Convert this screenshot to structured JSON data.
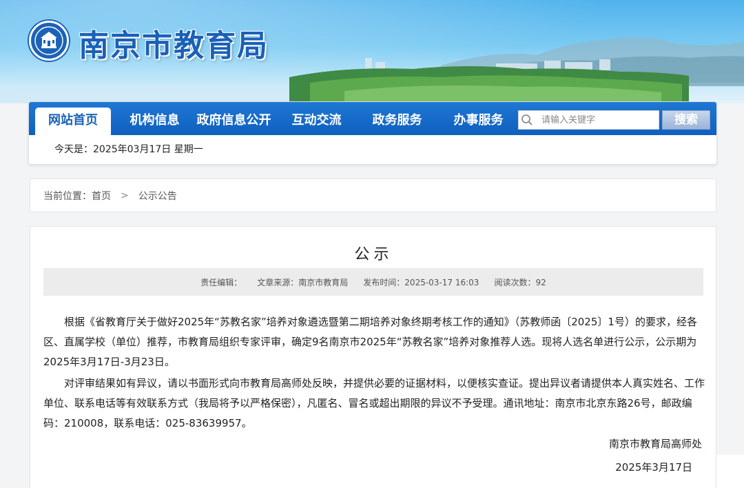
{
  "site": {
    "title": "南京市教育局"
  },
  "nav": {
    "items": [
      {
        "label": "网站首页",
        "active": true
      },
      {
        "label": "机构信息",
        "active": false
      },
      {
        "label": "政府信息公开",
        "active": false
      },
      {
        "label": "互动交流",
        "active": false
      },
      {
        "label": "政务服务",
        "active": false
      },
      {
        "label": "办事服务",
        "active": false
      }
    ],
    "search_placeholder": "请输入关键字",
    "search_button": "搜索",
    "today_text": "今天是：2025年03月17日  星期一"
  },
  "breadcrumb": {
    "prefix": "当前位置：",
    "home": "首页",
    "separator": ">",
    "current": "公示公告"
  },
  "article": {
    "title": "公示",
    "meta": {
      "editor": "责任编辑：",
      "source": "文章来源：南京市教育局",
      "time": "发布时间：2025-03-17 16:03",
      "reads": "阅读次数：92"
    },
    "paragraphs": [
      "根据《省教育厅关于做好2025年“苏教名家”培养对象遴选暨第二期培养对象终期考核工作的通知》（苏教师函〔2025〕1号）的要求，经各区、直属学校（单位）推荐，市教育局组织专家评审，确定9名南京市2025年“苏教名家”培养对象推荐人选。现将人选名单进行公示，公示期为2025年3月17日-3月23日。",
      "对评审结果如有异议，请以书面形式向市教育局高师处反映，并提供必要的证据材料，以便核实查证。提出异议者请提供本人真实姓名、工作单位、联系电话等有效联系方式（我局将予以严格保密），凡匿名、冒名或超出期限的异议不予受理。通讯地址：南京市北京东路26号，邮政编码：210008，联系电话：025-83639957。"
    ],
    "signature": "南京市教育局高师处",
    "date": "2025年3月17日"
  },
  "colors": {
    "brand_blue": "#1a63b8",
    "nav_bar": "#1667c7",
    "page_bg": "#f3f4f6"
  }
}
